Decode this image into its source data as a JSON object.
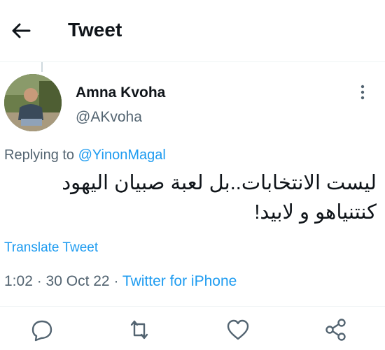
{
  "header": {
    "title": "Tweet",
    "back_icon": "arrow-left-icon"
  },
  "tweet": {
    "author": {
      "name": "Amna Kvoha",
      "handle": "@AKvoha"
    },
    "replying": {
      "prefix": "Replying to ",
      "mention": "@YinonMagal"
    },
    "text_lines": [
      "ليست الانتخابات..بل لعبة صبيان اليهود",
      "كنتنياهو و لابيد!"
    ],
    "translate_label": "Translate Tweet",
    "time": "1:02",
    "dot": " · ",
    "date": "30 Oct 22",
    "source": "Twitter for iPhone"
  },
  "actions": [
    "reply-icon",
    "retweet-icon",
    "like-icon",
    "share-icon"
  ],
  "colors": {
    "accent": "#1d9bf0",
    "text": "#0f1419",
    "secondary": "#536471",
    "divider": "#eff3f4"
  }
}
